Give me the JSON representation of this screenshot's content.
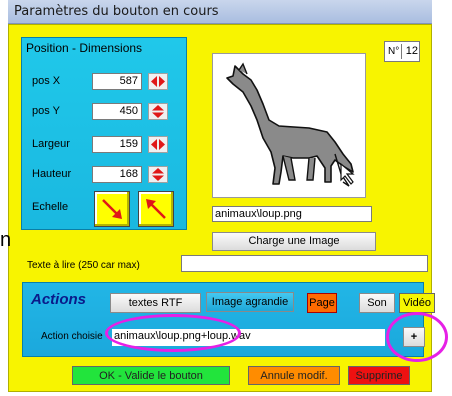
{
  "window": {
    "title": "Paramètres du bouton en cours"
  },
  "position": {
    "header": "Position - Dimensions",
    "rows": [
      {
        "label": "pos X",
        "value": "587"
      },
      {
        "label": "pos Y",
        "value": "450"
      },
      {
        "label": "Largeur",
        "value": "159"
      },
      {
        "label": "Hauteur",
        "value": "168"
      }
    ],
    "echelle_label": "Echelle"
  },
  "number": {
    "label": "N°",
    "value": "12"
  },
  "image": {
    "path": "animaux\\loup.png",
    "load_button": "Charge une Image",
    "icon": "wolf-howling-icon"
  },
  "text_to_read": {
    "label": "Texte à lire (250 car max)",
    "value": ""
  },
  "side_letter": "n",
  "actions": {
    "title": "Actions",
    "buttons": {
      "rtf": "textes RTF",
      "image": "Image agrandie",
      "page": "Page",
      "son": "Son",
      "video": "Vidéo"
    },
    "chosen_label": "Action choisie",
    "chosen_value": "animaux\\loup.png+loup.wav",
    "more_button": "+"
  },
  "footer": {
    "ok": "OK - Valide le bouton",
    "cancel": "Annule modif.",
    "delete": "Supprime"
  },
  "colors": {
    "window_bg": "#f8f400",
    "group_bg": "#1ab8e0",
    "highlight": "#e620e6",
    "ok_bg": "#22e43c",
    "cancel_bg": "#ff8c00",
    "delete_bg": "#ee1111"
  }
}
